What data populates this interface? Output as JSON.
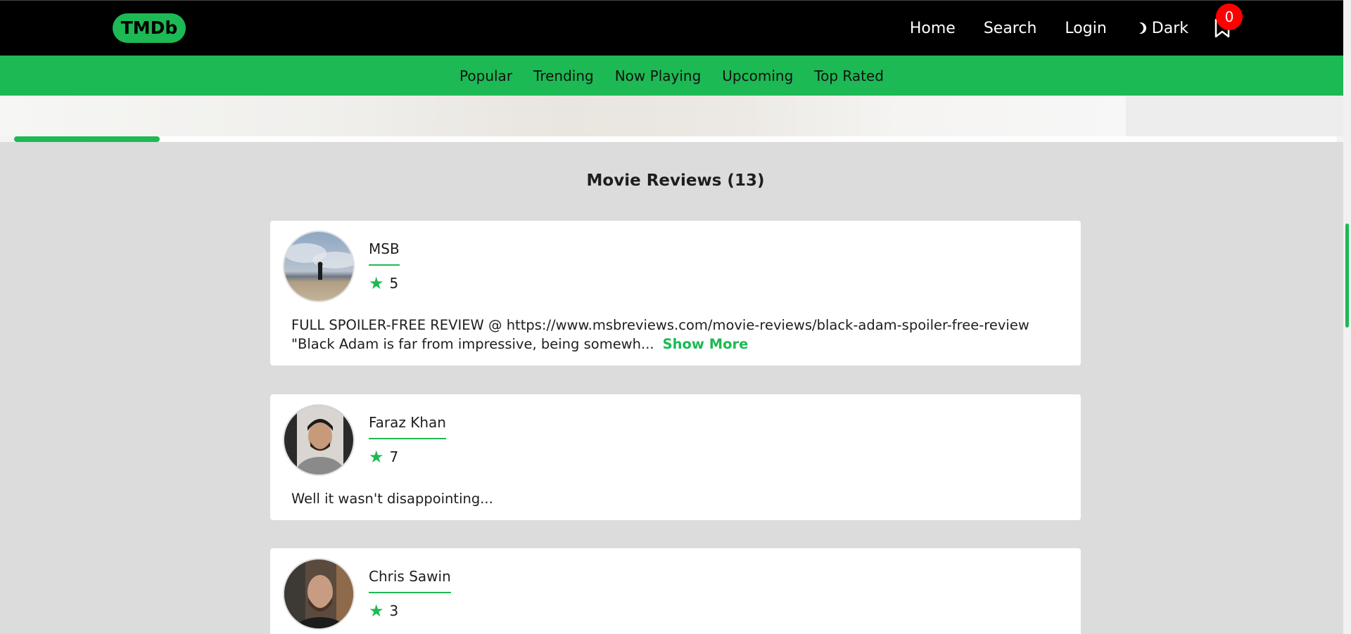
{
  "navbar": {
    "logo": "TMDb",
    "links": [
      "Home",
      "Search",
      "Login"
    ],
    "theme_label": "Dark",
    "watchlist_count": "0"
  },
  "subnav": [
    "Popular",
    "Trending",
    "Now Playing",
    "Upcoming",
    "Top Rated"
  ],
  "carousel_progress": 0.11,
  "reviews": {
    "title": "Movie Reviews (13)",
    "items": [
      {
        "author": "MSB",
        "rating": "5",
        "content": "FULL SPOILER-FREE REVIEW @ https://www.msbreviews.com/movie-reviews/black-adam-spoiler-free-review \"Black Adam is far from impressive, being somewh...",
        "show_more": "Show More"
      },
      {
        "author": "Faraz Khan",
        "rating": "7",
        "content": "Well it wasn't disappointing..."
      },
      {
        "author": "Chris Sawin",
        "rating": "3"
      }
    ]
  },
  "colors": {
    "accent": "#1db954",
    "navbar_bg": "#000000",
    "badge": "#ff0000",
    "page_bg": "#dcdcdc"
  }
}
